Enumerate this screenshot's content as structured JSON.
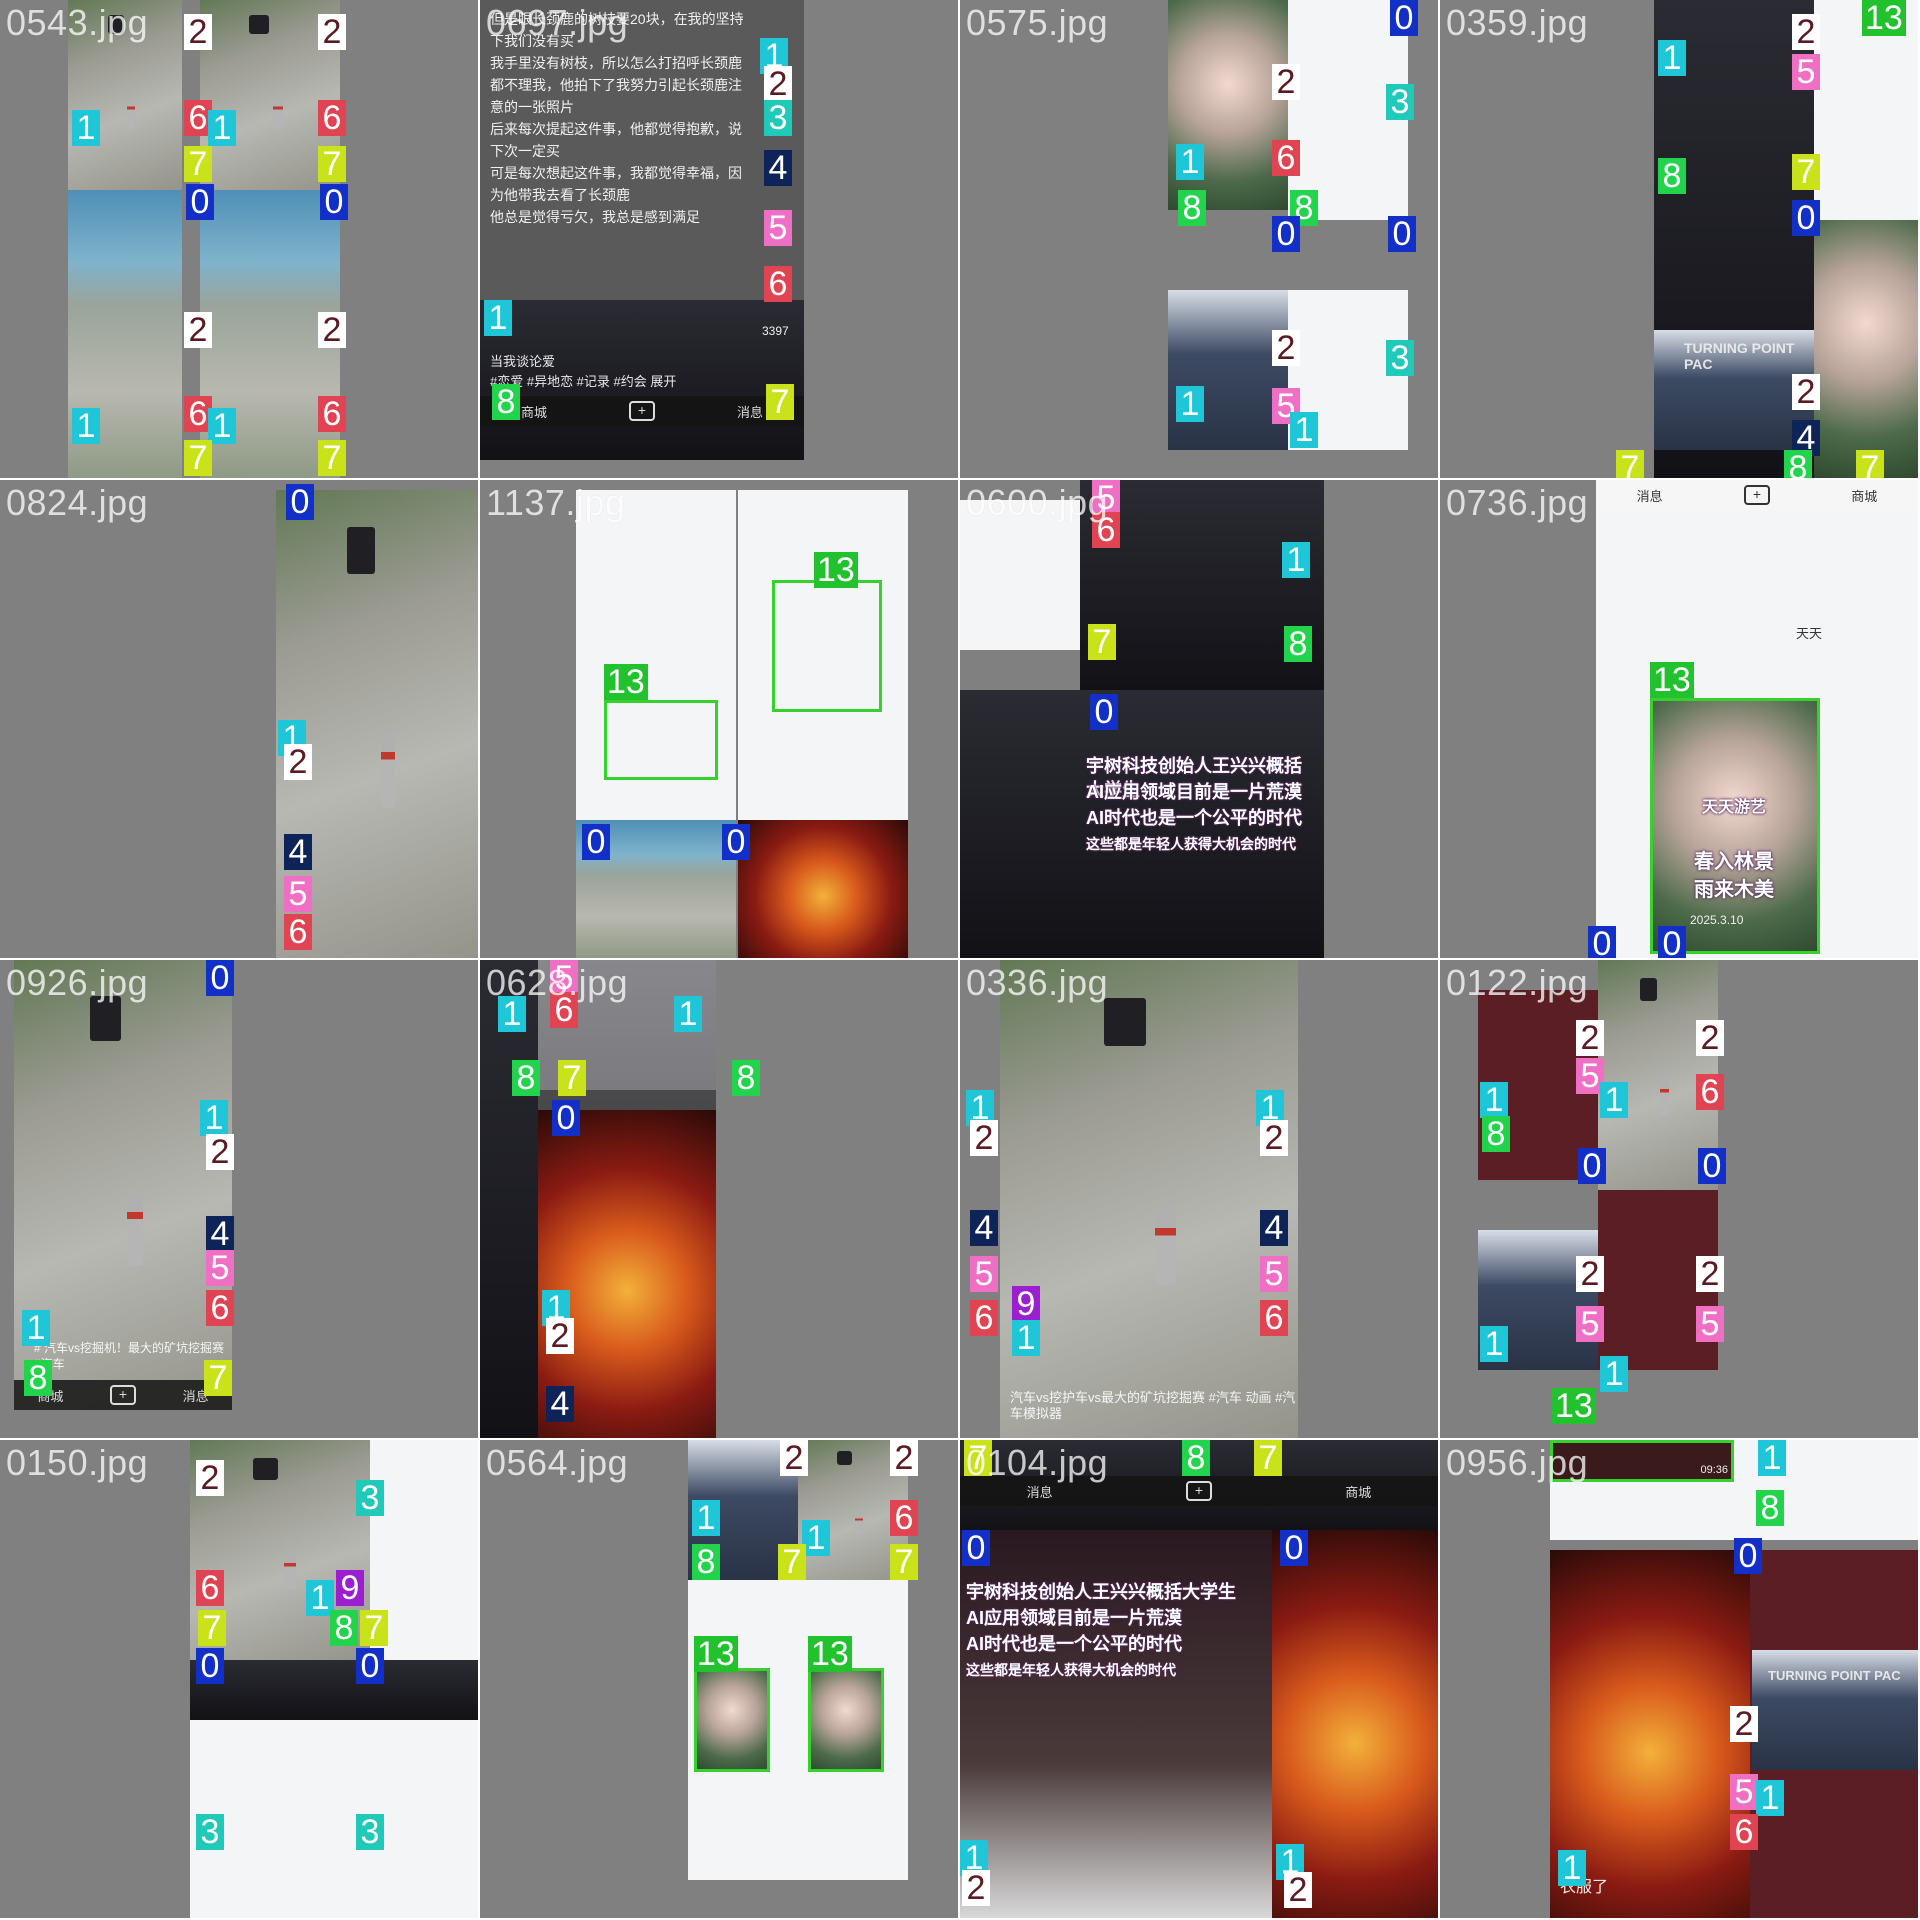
{
  "tiles": [
    {
      "file": "0543.jpg"
    },
    {
      "file": "0697.jpg"
    },
    {
      "file": "0575.jpg"
    },
    {
      "file": "0359.jpg"
    },
    {
      "file": "0824.jpg"
    },
    {
      "file": "1137.jpg"
    },
    {
      "file": "0600.jpg"
    },
    {
      "file": "0736.jpg"
    },
    {
      "file": "0926.jpg"
    },
    {
      "file": "0628.jpg"
    },
    {
      "file": "0336.jpg"
    },
    {
      "file": "0122.jpg"
    },
    {
      "file": "0150.jpg"
    },
    {
      "file": "0564.jpg"
    },
    {
      "file": "0104.jpg"
    },
    {
      "file": "0956.jpg"
    }
  ],
  "nav": {
    "mall": "商城",
    "message": "消息",
    "plus": "+"
  },
  "doc_0697": {
    "lines": [
      "但是眼长颈鹿的树枝要20块，在我的坚持",
      "下我们没有买",
      "我手里没有树枝，所以怎么打招呼长颈鹿",
      "都不理我，他拍下了我努力引起长颈鹿注",
      "意的一张照片",
      "后来每次提起这件事，他都觉得抱歉，说",
      "下次一定买",
      "可是每次想起这件事，我都觉得幸福，因",
      "为他带我去看了长颈鹿",
      "他总是觉得亏欠，我总是感到满足"
    ],
    "caption": "当我谈论爱",
    "tags": "#恋爱 #异地恋 #记录 #约会  展开",
    "count": "3397"
  },
  "headline_0600": [
    "宇树科技创始人王兴兴概括大学生",
    "AI应用领域目前是一片荒漠",
    "AI时代也是一个公平的时代",
    "这些都是年轻人获得大机会的时代"
  ],
  "video_0736": {
    "name": "天天",
    "sign": "天天游艺",
    "line1": "春入林景",
    "line2": "雨来木美",
    "date": "2025.3.10"
  },
  "caption_0926": "# 汽车vs挖掘机！最大的矿坑挖掘赛 #汽车",
  "caption_0336": "汽车vs挖护车vs最大的矿坑挖掘赛 #汽车 动画 #汽车模拟器",
  "caption_0956": "衣服了",
  "timer_0956": "09:36",
  "turning_point": "TURNING POINT PAC"
}
